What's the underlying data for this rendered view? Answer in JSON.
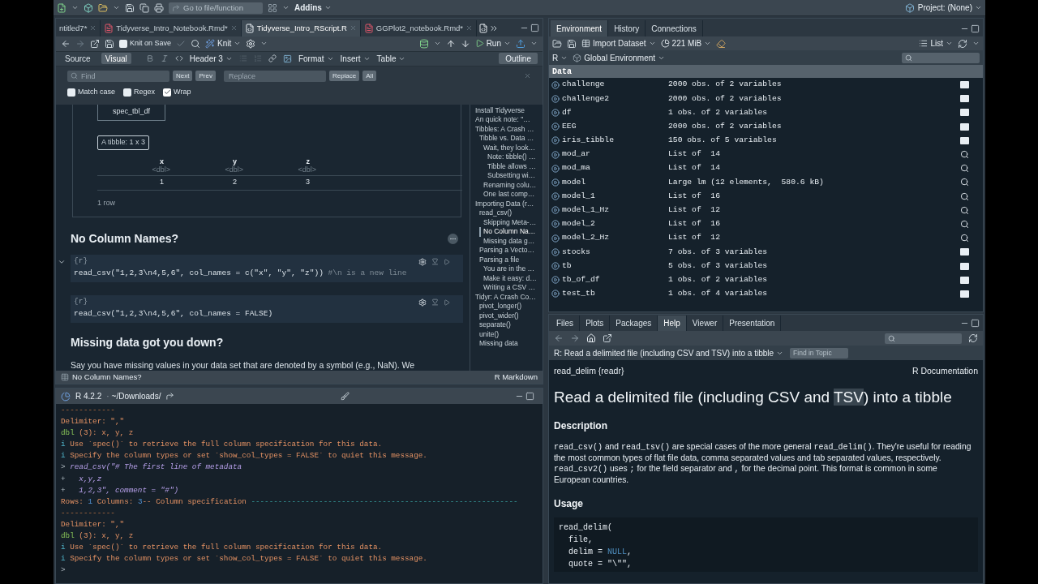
{
  "toolbar": {
    "goto_placeholder": "Go to file/function",
    "addins": "Addins",
    "project": "Project: (None)"
  },
  "source": {
    "tabs": [
      {
        "label": "ntitled7*",
        "kind": "none",
        "selected": false
      },
      {
        "label": "Tidyverse_Intro_Notebook.Rmd*",
        "kind": "rmd",
        "selected": false
      },
      {
        "label": "Tidyverse_Intro_RScript.R",
        "kind": "r",
        "selected": true
      },
      {
        "label": "GGPlot2_notebook.Rmd*",
        "kind": "rmd",
        "selected": false
      }
    ],
    "knit_on_save": {
      "label": "Knit on Save",
      "checked": false
    },
    "knit": "Knit",
    "run": "Run",
    "modes": [
      {
        "label": "Source",
        "selected": false
      },
      {
        "label": "Visual",
        "selected": true
      }
    ],
    "header_style": "Header 3",
    "menus": [
      "Format",
      "Insert",
      "Table"
    ],
    "outline_button": "Outline",
    "find": {
      "find_placeholder": "Find",
      "next": "Next",
      "prev": "Prev",
      "replace_placeholder": "Replace",
      "replace": "Replace",
      "all": "All",
      "options": [
        {
          "label": "Match case",
          "checked": false
        },
        {
          "label": "Regex",
          "checked": false
        },
        {
          "label": "Wrap",
          "checked": true
        }
      ]
    },
    "document": [
      {
        "kind": "output",
        "tab": "spec_tbl_df",
        "badge": "A tibble: 1 x 3",
        "columns": [
          {
            "name": "x",
            "type": "<dbl>"
          },
          {
            "name": "y",
            "type": "<dbl>"
          },
          {
            "name": "z",
            "type": "<dbl>"
          }
        ],
        "rows": [
          [
            "1",
            "2",
            "3"
          ]
        ],
        "footer": "1 row"
      },
      {
        "kind": "heading",
        "text": "No Column Names?"
      },
      {
        "kind": "chunk",
        "header": "{r}",
        "code": "read_csv(\"1,2,3\\n4,5,6\", col_names = c(\"x\", \"y\", \"z\"))",
        "comment": " #\\n is a new line",
        "collapsible": true
      },
      {
        "kind": "chunk",
        "header": "{r}",
        "code": "read_csv(\"1,2,3\\n4,5,6\", col_names = FALSE)",
        "collapsible": false
      },
      {
        "kind": "heading",
        "text": "Missing data got you down?"
      },
      {
        "kind": "paragraph",
        "text": "Say you have missing values in your data set that are denoted by a symbol (e.g., NaN). We"
      }
    ],
    "outline": [
      {
        "label": "Install Tidyverse",
        "selected": false
      },
      {
        "label": "An quick note: \"…",
        "selected": false
      },
      {
        "label": "Tibbles: A Crash …",
        "selected": false,
        "children": [
          {
            "label": "Tibble vs. Data …",
            "selected": false,
            "children": [
              {
                "label": "Wait, they look…",
                "selected": false,
                "children": [
                  {
                    "label": "Note: tibble() …",
                    "selected": false
                  },
                  {
                    "label": "Tibble allows …",
                    "selected": false
                  },
                  {
                    "label": "Subsetting wi…",
                    "selected": false
                  }
                ]
              },
              {
                "label": "Renaming colu…",
                "selected": false
              },
              {
                "label": "One last comp…",
                "selected": false
              }
            ]
          }
        ]
      },
      {
        "label": "Importing Data (r…",
        "selected": false,
        "children": [
          {
            "label": "read_csv()",
            "selected": false,
            "children": [
              {
                "label": "Skipping Meta-…",
                "selected": false
              },
              {
                "label": "No Column Na…",
                "selected": true
              },
              {
                "label": "Missing data g…",
                "selected": false
              }
            ]
          },
          {
            "label": "Parsing a Vecto…",
            "selected": false
          },
          {
            "label": "Parsing a file",
            "selected": false,
            "children": [
              {
                "label": "You are in the …",
                "selected": false
              },
              {
                "label": "Make it easy: d…",
                "selected": false
              },
              {
                "label": "Writing a CSV …",
                "selected": false
              }
            ]
          }
        ]
      },
      {
        "label": "Tidyr: A Crash Co…",
        "selected": false,
        "children": [
          {
            "label": "pivot_longer()",
            "selected": false
          },
          {
            "label": "pivot_wider()",
            "selected": false
          },
          {
            "label": "separate()",
            "selected": false
          },
          {
            "label": "unite()",
            "selected": false
          },
          {
            "label": "Missing data",
            "selected": false
          }
        ]
      }
    ],
    "status": {
      "section": "No Column Names?",
      "mode": "R Markdown"
    }
  },
  "console": {
    "version": "R 4.2.2",
    "separator": "·",
    "path": "~/Downloads/",
    "lines": [
      [
        {
          "text": "------------",
          "kind": "dim"
        }
      ],
      [
        {
          "text": "Delimiter: \",\"",
          "kind": "message"
        }
      ],
      [
        {
          "text": "dbl",
          "kind": "type"
        },
        {
          "text": " (3): x, y, z",
          "kind": "message"
        }
      ],
      [
        {
          "text": "i",
          "kind": "info"
        },
        {
          "text": " Use `spec()` to retrieve the full column specification for this data.",
          "kind": "message"
        }
      ],
      [
        {
          "text": "i",
          "kind": "info"
        },
        {
          "text": " Specify the column types or set `show_col_types = FALSE` to quiet this message.",
          "kind": "message"
        }
      ],
      [
        {
          "text": ">",
          "kind": "prompt"
        },
        {
          "text": " read_csv(\"# The first line of metadata",
          "kind": "input"
        }
      ],
      [
        {
          "text": "+",
          "kind": "prompt"
        },
        {
          "text": "   x,y,z",
          "kind": "input"
        }
      ],
      [
        {
          "text": "+",
          "kind": "prompt"
        },
        {
          "text": "   1,2,3\", comment = \"#\")",
          "kind": "input"
        }
      ],
      [
        {
          "text": "Rows: ",
          "kind": "message"
        },
        {
          "text": "1",
          "kind": "number"
        },
        {
          "text": " Columns: ",
          "kind": "message"
        },
        {
          "text": "3",
          "kind": "number"
        },
        {
          "text": "-- Column specification ",
          "kind": "message"
        },
        {
          "text": "-----------------------------------------------------------",
          "kind": "rule"
        }
      ],
      [
        {
          "text": "------------",
          "kind": "dim"
        }
      ],
      [
        {
          "text": "Delimiter: \",\"",
          "kind": "message"
        }
      ],
      [
        {
          "text": "dbl",
          "kind": "type"
        },
        {
          "text": " (3): x, y, z",
          "kind": "message"
        }
      ],
      [
        {
          "text": "i",
          "kind": "info"
        },
        {
          "text": " Use `spec()` to retrieve the full column specification for this data.",
          "kind": "message"
        }
      ],
      [
        {
          "text": "i",
          "kind": "info"
        },
        {
          "text": " Specify the column types or set `show_col_types = FALSE` to quiet this message.",
          "kind": "message"
        }
      ],
      [
        {
          "text": ">",
          "kind": "prompt"
        }
      ]
    ]
  },
  "environment": {
    "tabs": [
      {
        "label": "Environment",
        "selected": true
      },
      {
        "label": "History",
        "selected": false
      },
      {
        "label": "Connections",
        "selected": false
      }
    ],
    "import": "Import Dataset",
    "memory": "221 MiB",
    "view": "List",
    "language": "R",
    "scope": "Global Environment",
    "section": "Data",
    "rows": [
      {
        "name": "challenge",
        "value": "2000 obs. of 2 variables",
        "kind": "data"
      },
      {
        "name": "challenge2",
        "value": "2000 obs. of 2 variables",
        "kind": "data"
      },
      {
        "name": "df",
        "value": "1 obs. of 2 variables",
        "kind": "data"
      },
      {
        "name": "EEG",
        "value": "2000 obs. of 2 variables",
        "kind": "data"
      },
      {
        "name": "iris_tibble",
        "value": "150 obs. of 5 variables",
        "kind": "data"
      },
      {
        "name": "mod_ar",
        "value": "List of  14",
        "kind": "list"
      },
      {
        "name": "mod_ma",
        "value": "List of  14",
        "kind": "list"
      },
      {
        "name": "model",
        "value": "Large lm (12 elements,  580.6 kB)",
        "kind": "list"
      },
      {
        "name": "model_1",
        "value": "List of  16",
        "kind": "list"
      },
      {
        "name": "model_1_Hz",
        "value": "List of  12",
        "kind": "list"
      },
      {
        "name": "model_2",
        "value": "List of  16",
        "kind": "list"
      },
      {
        "name": "model_2_Hz",
        "value": "List of  12",
        "kind": "list"
      },
      {
        "name": "stocks",
        "value": "7 obs. of 3 variables",
        "kind": "data"
      },
      {
        "name": "tb",
        "value": "5 obs. of 3 variables",
        "kind": "data"
      },
      {
        "name": "tb_of_df",
        "value": "1 obs. of 2 variables",
        "kind": "data"
      },
      {
        "name": "test_tb",
        "value": "1 obs. of 4 variables",
        "kind": "data"
      }
    ]
  },
  "help": {
    "tabs": [
      {
        "label": "Files",
        "selected": false
      },
      {
        "label": "Plots",
        "selected": false
      },
      {
        "label": "Packages",
        "selected": false
      },
      {
        "label": "Help",
        "selected": true
      },
      {
        "label": "Viewer",
        "selected": false
      },
      {
        "label": "Presentation",
        "selected": false
      }
    ],
    "topic": "R: Read a delimited file (including CSV and TSV) into a tibble",
    "find_placeholder": "Find in Topic",
    "package": "read_delim {readr}",
    "doc_label": "R Documentation",
    "title": [
      {
        "text": "Read a delimited file (including CSV and ",
        "highlight": false
      },
      {
        "text": "TSV",
        "highlight": true
      },
      {
        "text": ") into a tibble",
        "highlight": false
      }
    ],
    "description_heading": "Description",
    "description": [
      {
        "text": "read_csv()",
        "kind": "code"
      },
      {
        "text": " and ",
        "kind": "text"
      },
      {
        "text": "read_tsv()",
        "kind": "code"
      },
      {
        "text": " are special cases of the more general ",
        "kind": "text"
      },
      {
        "text": "read_delim()",
        "kind": "code"
      },
      {
        "text": ". They're useful for reading the most common types of flat file data, comma separated values and tab separated values, respectively. ",
        "kind": "text"
      },
      {
        "text": "read_csv2()",
        "kind": "code"
      },
      {
        "text": " uses ",
        "kind": "text"
      },
      {
        "text": ";",
        "kind": "code"
      },
      {
        "text": " for the field separator and ",
        "kind": "text"
      },
      {
        "text": ",",
        "kind": "code"
      },
      {
        "text": " for the decimal point. This format is common in some European countries.",
        "kind": "text"
      }
    ],
    "usage_heading": "Usage",
    "usage": [
      [
        {
          "text": "read_delim(",
          "kind": "code"
        }
      ],
      [
        {
          "text": "  file,",
          "kind": "code"
        }
      ],
      [
        {
          "text": "  delim = ",
          "kind": "code"
        },
        {
          "text": "NULL",
          "kind": "keyword"
        },
        {
          "text": ",",
          "kind": "code"
        }
      ],
      [
        {
          "text": "  quote = \"\\\"\",",
          "kind": "code"
        }
      ]
    ]
  }
}
